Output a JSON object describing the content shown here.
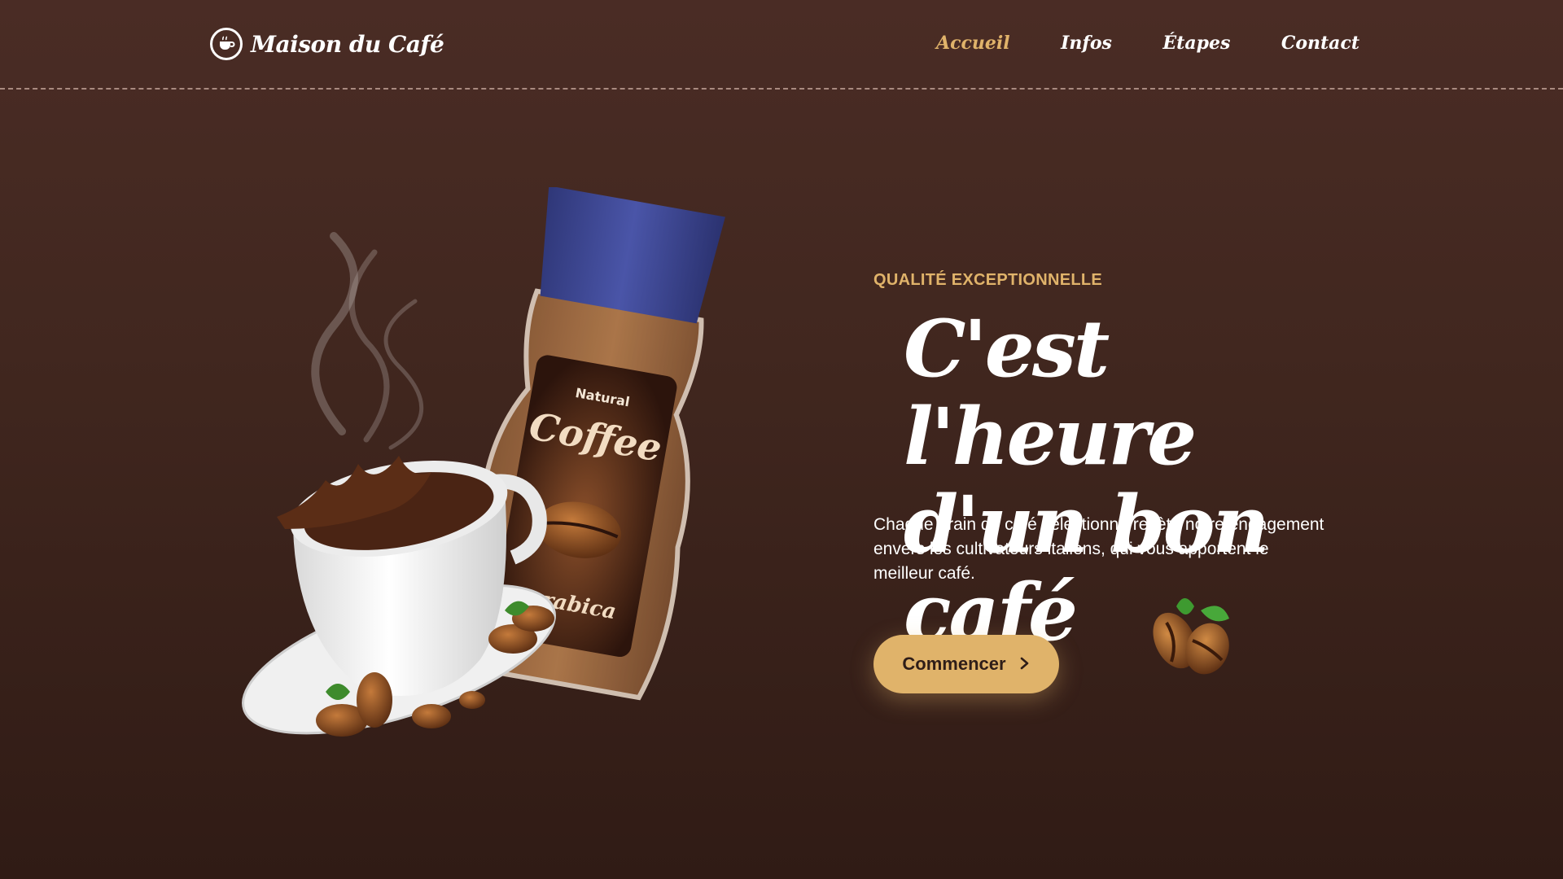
{
  "brand": {
    "name": "Maison du Café",
    "logo_icon": "coffee-cup-icon"
  },
  "nav": {
    "items": [
      {
        "label": "Accueil",
        "active": true
      },
      {
        "label": "Infos",
        "active": false
      },
      {
        "label": "Étapes",
        "active": false
      },
      {
        "label": "Contact",
        "active": false
      }
    ]
  },
  "hero": {
    "eyebrow": "QUALITÉ EXCEPTIONNELLE",
    "headline_line1": "C'est l'heure",
    "headline_line2": "d'un bon café",
    "description": "Chaque grain de café sélectionné reflète notre engagement envers les cultivateurs italiens, qui vous apportent le meilleur café.",
    "cta_label": "Commencer",
    "cta_icon": "chevron-right-icon"
  },
  "jar_label": {
    "top": "Natural",
    "title": "Coffee",
    "variety": "arabica"
  },
  "colors": {
    "background": "#41271f",
    "accent": "#e0b36a",
    "text": "#ffffff",
    "jar_lid": "#3d4691"
  }
}
